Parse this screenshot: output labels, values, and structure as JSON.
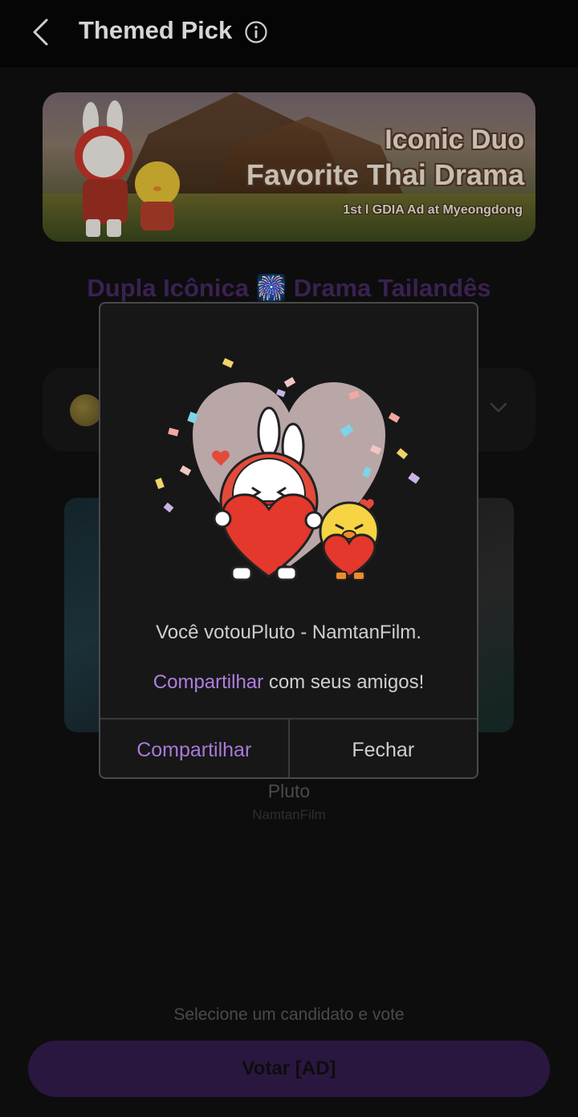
{
  "header": {
    "title": "Themed Pick"
  },
  "banner": {
    "line1": "Iconic Duo",
    "line2": "Favorite Thai Drama",
    "line3": "1st l GDIA Ad at Myeongdong"
  },
  "page": {
    "subtitle": "Dupla Icônica 🎆 Drama Tailandês"
  },
  "candidate": {
    "name": "Pluto",
    "subtitle": "NamtanFilm"
  },
  "footer": {
    "hint": "Selecione um candidato e vote",
    "vote_label": "Votar [AD]"
  },
  "dialog": {
    "message": "Você votouPluto - NamtanFilm.",
    "share_link_text": "Compartilhar",
    "share_suffix": " com seus amigos!",
    "share_button": "Compartilhar",
    "close_button": "Fechar"
  },
  "colors": {
    "accent": "#b07ee0",
    "background": "#0d0d0d",
    "dialog_bg": "#171717"
  },
  "icons": {
    "back": "chevron-left-icon",
    "info": "info-icon",
    "dropdown": "chevron-down-icon",
    "coin": "coin-icon"
  }
}
